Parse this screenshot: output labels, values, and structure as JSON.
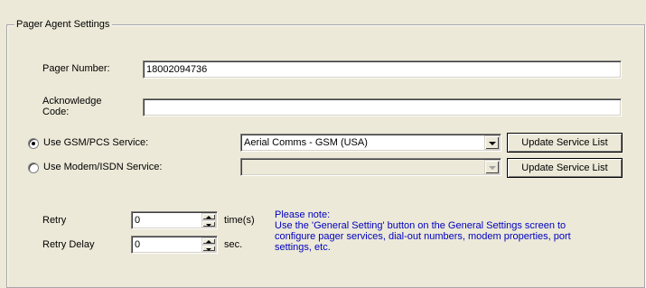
{
  "group": {
    "title": "Pager Agent Settings"
  },
  "pager_number": {
    "label": "Pager Number:",
    "value": "18002094736"
  },
  "ack_code": {
    "label_line1": "Acknowledge",
    "label_line2": "Code:",
    "value": ""
  },
  "gsm": {
    "label": "Use GSM/PCS Service:",
    "selected": true,
    "service_value": "Aerial Comms - GSM (USA)",
    "update_label": "Update Service List"
  },
  "modem": {
    "label": "Use Modem/ISDN Service:",
    "selected": false,
    "service_value": "",
    "update_label": "Update Service List"
  },
  "retry": {
    "label": "Retry",
    "value": "0",
    "unit": "time(s)"
  },
  "retry_delay": {
    "label": "Retry Delay",
    "value": "0",
    "unit": "sec."
  },
  "note": {
    "line1": "Please note:",
    "line2": "Use the 'General Setting' button on the General Settings screen to",
    "line3": "configure pager services, dial-out numbers, modem properties, port",
    "line4": "settings, etc."
  }
}
